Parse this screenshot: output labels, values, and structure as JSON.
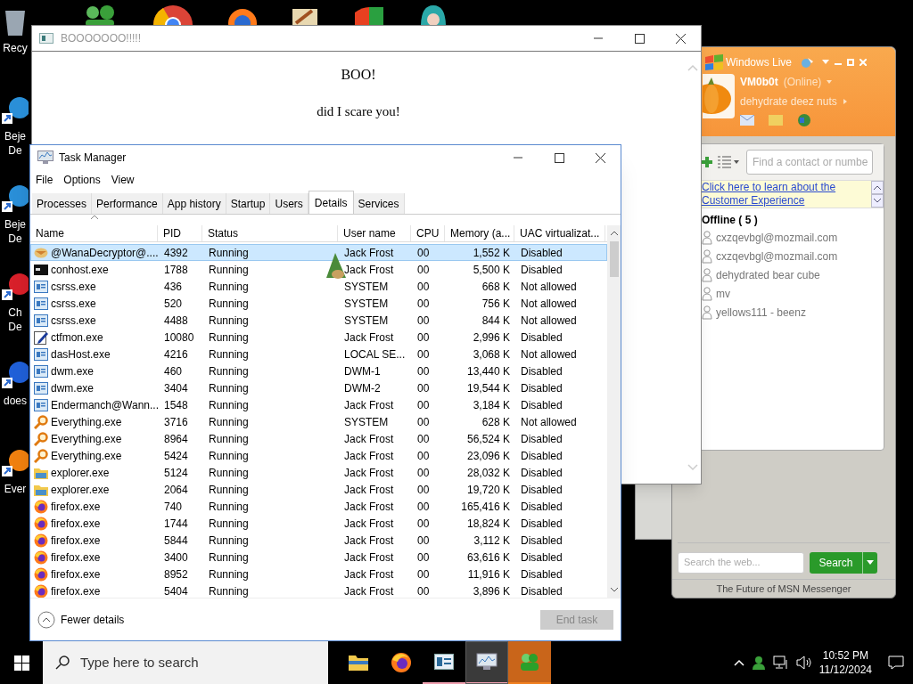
{
  "desktop_icons": [
    {
      "kind": "bin",
      "lines": [
        "Recy"
      ]
    },
    {
      "kind": "gem",
      "lines": [
        "Beje",
        "De"
      ]
    },
    {
      "kind": "gem",
      "lines": [
        "Beje",
        "De"
      ]
    },
    {
      "kind": "heart",
      "lines": [
        "Ch",
        "De"
      ]
    },
    {
      "kind": "flame",
      "lines": [
        "does"
      ]
    },
    {
      "kind": "orb",
      "lines": [
        "Ever"
      ]
    }
  ],
  "top_icons": [
    {
      "kind": "people"
    },
    {
      "kind": "chrome"
    },
    {
      "kind": "firefox"
    },
    {
      "kind": "tool"
    },
    {
      "kind": "shield"
    },
    {
      "kind": "hair"
    }
  ],
  "boo_window": {
    "title": "BOOOOOOO!!!!!",
    "heading": "BOO!",
    "message": "did I scare you!"
  },
  "task_manager": {
    "title": "Task Manager",
    "menu": [
      "File",
      "Options",
      "View"
    ],
    "tabs": [
      {
        "label": "Processes",
        "selected": false
      },
      {
        "label": "Performance",
        "selected": false
      },
      {
        "label": "App history",
        "selected": false
      },
      {
        "label": "Startup",
        "selected": false
      },
      {
        "label": "Users",
        "selected": false
      },
      {
        "label": "Details",
        "selected": true
      },
      {
        "label": "Services",
        "selected": false
      }
    ],
    "columns": [
      "Name",
      "PID",
      "Status",
      "User name",
      "CPU",
      "Memory (a...",
      "UAC virtualizat..."
    ],
    "rows": [
      {
        "kind": "wana",
        "name": "@WanaDecryptor@....",
        "pid": "4392",
        "status": "Running",
        "user": "Jack Frost",
        "cpu": "00",
        "memory": "1,552 K",
        "uac": "Disabled",
        "selected": true
      },
      {
        "kind": "console",
        "name": "conhost.exe",
        "pid": "1788",
        "status": "Running",
        "user": "Jack Frost",
        "cpu": "00",
        "memory": "5,500 K",
        "uac": "Disabled",
        "selected": false
      },
      {
        "kind": "app",
        "name": "csrss.exe",
        "pid": "436",
        "status": "Running",
        "user": "SYSTEM",
        "cpu": "00",
        "memory": "668 K",
        "uac": "Not allowed",
        "selected": false
      },
      {
        "kind": "app",
        "name": "csrss.exe",
        "pid": "520",
        "status": "Running",
        "user": "SYSTEM",
        "cpu": "00",
        "memory": "756 K",
        "uac": "Not allowed",
        "selected": false
      },
      {
        "kind": "app",
        "name": "csrss.exe",
        "pid": "4488",
        "status": "Running",
        "user": "SYSTEM",
        "cpu": "00",
        "memory": "844 K",
        "uac": "Not allowed",
        "selected": false
      },
      {
        "kind": "pen",
        "name": "ctfmon.exe",
        "pid": "10080",
        "status": "Running",
        "user": "Jack Frost",
        "cpu": "00",
        "memory": "2,996 K",
        "uac": "Disabled",
        "selected": false
      },
      {
        "kind": "app",
        "name": "dasHost.exe",
        "pid": "4216",
        "status": "Running",
        "user": "LOCAL SE...",
        "cpu": "00",
        "memory": "3,068 K",
        "uac": "Not allowed",
        "selected": false
      },
      {
        "kind": "app",
        "name": "dwm.exe",
        "pid": "460",
        "status": "Running",
        "user": "DWM-1",
        "cpu": "00",
        "memory": "13,440 K",
        "uac": "Disabled",
        "selected": false
      },
      {
        "kind": "app",
        "name": "dwm.exe",
        "pid": "3404",
        "status": "Running",
        "user": "DWM-2",
        "cpu": "00",
        "memory": "19,544 K",
        "uac": "Disabled",
        "selected": false
      },
      {
        "kind": "app",
        "name": "Endermanch@Wann...",
        "pid": "1548",
        "status": "Running",
        "user": "Jack Frost",
        "cpu": "00",
        "memory": "3,184 K",
        "uac": "Disabled",
        "selected": false
      },
      {
        "kind": "magnifier",
        "name": "Everything.exe",
        "pid": "3716",
        "status": "Running",
        "user": "SYSTEM",
        "cpu": "00",
        "memory": "628 K",
        "uac": "Not allowed",
        "selected": false
      },
      {
        "kind": "magnifier",
        "name": "Everything.exe",
        "pid": "8964",
        "status": "Running",
        "user": "Jack Frost",
        "cpu": "00",
        "memory": "56,524 K",
        "uac": "Disabled",
        "selected": false
      },
      {
        "kind": "magnifier",
        "name": "Everything.exe",
        "pid": "5424",
        "status": "Running",
        "user": "Jack Frost",
        "cpu": "00",
        "memory": "23,096 K",
        "uac": "Disabled",
        "selected": false
      },
      {
        "kind": "folder",
        "name": "explorer.exe",
        "pid": "5124",
        "status": "Running",
        "user": "Jack Frost",
        "cpu": "00",
        "memory": "28,032 K",
        "uac": "Disabled",
        "selected": false
      },
      {
        "kind": "folder",
        "name": "explorer.exe",
        "pid": "2064",
        "status": "Running",
        "user": "Jack Frost",
        "cpu": "00",
        "memory": "19,720 K",
        "uac": "Disabled",
        "selected": false
      },
      {
        "kind": "firefox",
        "name": "firefox.exe",
        "pid": "740",
        "status": "Running",
        "user": "Jack Frost",
        "cpu": "00",
        "memory": "165,416 K",
        "uac": "Disabled",
        "selected": false
      },
      {
        "kind": "firefox",
        "name": "firefox.exe",
        "pid": "1744",
        "status": "Running",
        "user": "Jack Frost",
        "cpu": "00",
        "memory": "18,824 K",
        "uac": "Disabled",
        "selected": false
      },
      {
        "kind": "firefox",
        "name": "firefox.exe",
        "pid": "5844",
        "status": "Running",
        "user": "Jack Frost",
        "cpu": "00",
        "memory": "3,112 K",
        "uac": "Disabled",
        "selected": false
      },
      {
        "kind": "firefox",
        "name": "firefox.exe",
        "pid": "3400",
        "status": "Running",
        "user": "Jack Frost",
        "cpu": "00",
        "memory": "63,616 K",
        "uac": "Disabled",
        "selected": false
      },
      {
        "kind": "firefox",
        "name": "firefox.exe",
        "pid": "8952",
        "status": "Running",
        "user": "Jack Frost",
        "cpu": "00",
        "memory": "11,916 K",
        "uac": "Disabled",
        "selected": false
      },
      {
        "kind": "firefox",
        "name": "firefox.exe",
        "pid": "5404",
        "status": "Running",
        "user": "Jack Frost",
        "cpu": "00",
        "memory": "3,896 K",
        "uac": "Disabled",
        "selected": false
      }
    ],
    "fewer_details": "Fewer details",
    "end_task": {
      "label": "End task",
      "disabled": true
    }
  },
  "messenger": {
    "brand": "Windows Live",
    "user": "VM0b0t",
    "presence": "(Online)",
    "status_message": "dehydrate deez nuts",
    "find_placeholder": "Find a contact or numbe",
    "banner_link": "Click here to learn about the Customer Experience",
    "group": "Offline ( 5 )",
    "contacts": [
      "cxzqevbgl@mozmail.com",
      "cxzqevbgl@mozmail.com",
      "dehydrated bear cube",
      "mv",
      "yellows111 - beenz"
    ],
    "web_search_placeholder": "Search the web...",
    "search_button": "Search",
    "footer": "The Future of MSN Messenger"
  },
  "taskbar": {
    "search_placeholder": "Type here to search",
    "apps": [
      {
        "kind": "folder",
        "running": false,
        "selected": false,
        "attention": false
      },
      {
        "kind": "firefox",
        "running": false,
        "selected": false,
        "attention": false
      },
      {
        "kind": "window",
        "running": true,
        "selected": false,
        "attention": false
      },
      {
        "kind": "taskmgr",
        "running": true,
        "selected": true,
        "attention": false
      },
      {
        "kind": "messenger",
        "running": true,
        "selected": false,
        "attention": true
      }
    ],
    "time": "10:52 PM",
    "date": "11/12/2024"
  }
}
